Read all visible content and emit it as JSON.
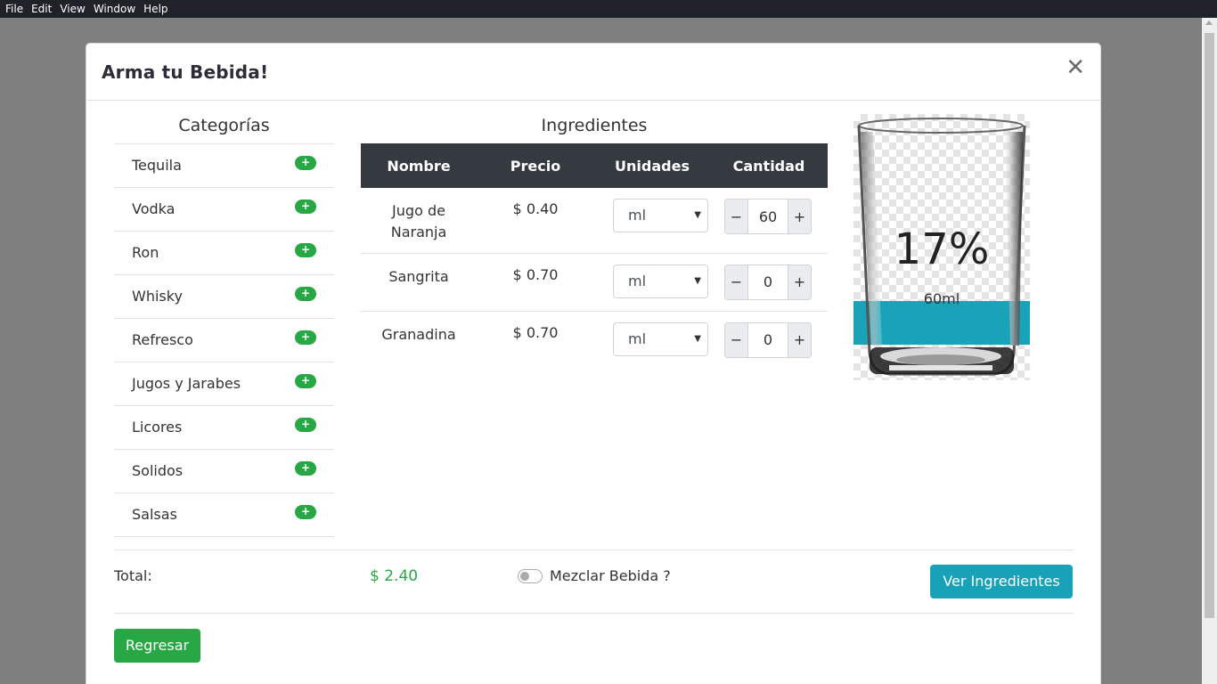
{
  "menubar": {
    "items": [
      "File",
      "Edit",
      "View",
      "Window",
      "Help"
    ]
  },
  "modal": {
    "title": "Arma tu Bebida!",
    "close_symbol": "✕"
  },
  "categories": {
    "title": "Categorías",
    "add_symbol": "+",
    "items": [
      "Tequila",
      "Vodka",
      "Ron",
      "Whisky",
      "Refresco",
      "Jugos y Jarabes",
      "Licores",
      "Solidos",
      "Salsas"
    ]
  },
  "ingredients": {
    "title": "Ingredientes",
    "columns": [
      "Nombre",
      "Precio",
      "Unidades",
      "Cantidad"
    ],
    "rows": [
      {
        "name": "Jugo de Naranja",
        "price": "$ 0.40",
        "unit": "ml",
        "quantity": "60"
      },
      {
        "name": "Sangrita",
        "price": "$ 0.70",
        "unit": "ml",
        "quantity": "0"
      },
      {
        "name": "Granadina",
        "price": "$ 0.70",
        "unit": "ml",
        "quantity": "0"
      }
    ],
    "stepper_minus": "−",
    "stepper_plus": "+"
  },
  "glass": {
    "percent_label": "17%",
    "fill_fraction": 0.17,
    "volume_label": "60ml",
    "fill_color": "#1aa3b8"
  },
  "footer": {
    "total_label": "Total:",
    "total_value": "$ 2.40",
    "mix_label": "Mezclar Bebida ?",
    "mix_enabled": false,
    "view_button": "Ver Ingredientes",
    "back_button": "Regresar"
  },
  "colors": {
    "success": "#28a745",
    "info": "#17a2b8",
    "table_header": "#343a40"
  }
}
